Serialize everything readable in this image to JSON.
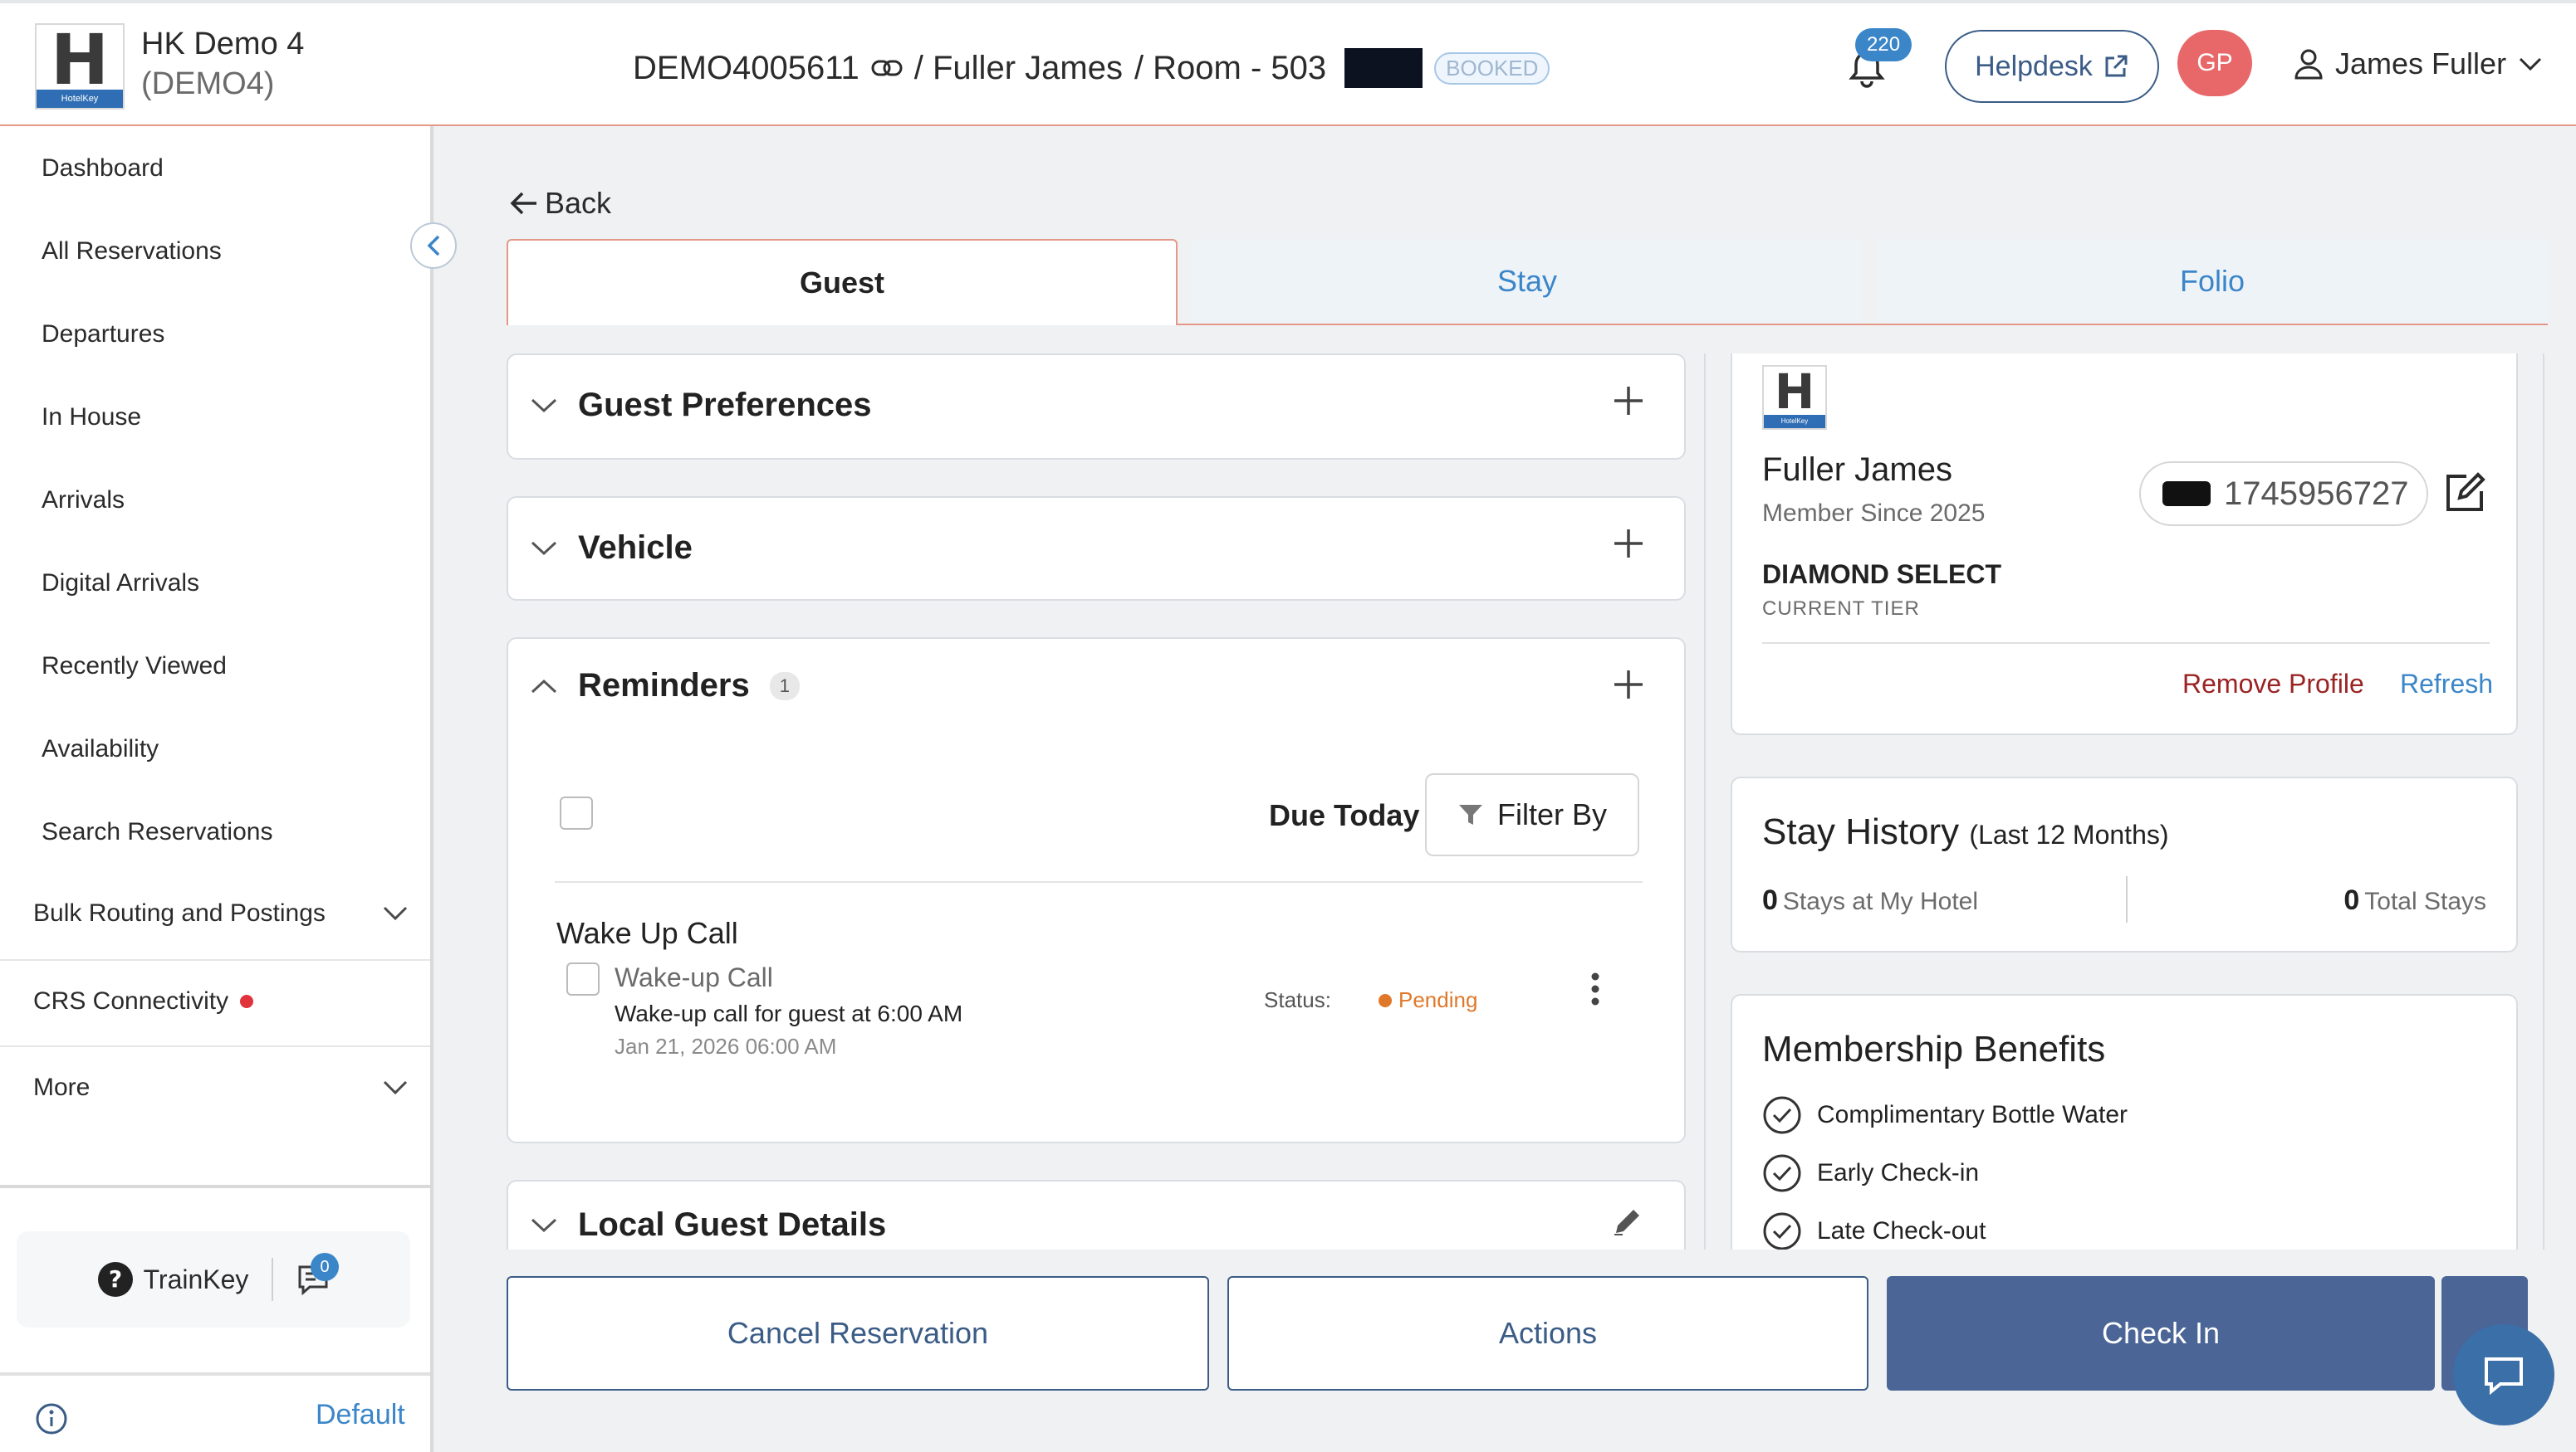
{
  "header": {
    "hotel_name": "HK Demo 4",
    "hotel_code": "(DEMO4)",
    "logo_letter": "H",
    "logo_band": "HotelKey",
    "reservation_id": "DEMO4005611",
    "guest_path": "/ Fuller James",
    "room_path": "/ Room - 503",
    "status_badge": "BOOKED",
    "notification_count": "220",
    "helpdesk_label": "Helpdesk",
    "avatar_initials": "GP",
    "user_name": "James Fuller"
  },
  "sidebar": {
    "items": [
      {
        "label": "Dashboard"
      },
      {
        "label": "All Reservations"
      },
      {
        "label": "Departures"
      },
      {
        "label": "In House"
      },
      {
        "label": "Arrivals"
      },
      {
        "label": "Digital Arrivals"
      },
      {
        "label": "Recently Viewed"
      },
      {
        "label": "Availability"
      },
      {
        "label": "Search Reservations"
      }
    ],
    "bulk_routing": "Bulk Routing and Postings",
    "crs": "CRS Connectivity",
    "more": "More",
    "trainkey": "TrainKey",
    "message_count": "0",
    "default_label": "Default"
  },
  "main": {
    "back_label": "Back",
    "tabs": [
      {
        "label": "Guest",
        "active": true
      },
      {
        "label": "Stay",
        "active": false
      },
      {
        "label": "Folio",
        "active": false
      }
    ],
    "sections": {
      "guest_preferences": "Guest Preferences",
      "vehicle": "Vehicle",
      "reminders": "Reminders",
      "reminders_count": "1",
      "local_guest_details": "Local Guest Details"
    },
    "reminders": {
      "due_today": "Due Today",
      "filter_by": "Filter By",
      "group_title": "Wake Up Call",
      "item_name": "Wake-up Call",
      "item_desc": "Wake-up call for guest at 6:00 AM",
      "item_date": "Jan 21, 2026 06:00 AM",
      "status_label": "Status:",
      "status_value": "Pending"
    }
  },
  "profile": {
    "logo_letter": "H",
    "logo_band": "HotelKey",
    "guest_name": "Fuller James",
    "member_since": "Member Since 2025",
    "loyalty_number": "1745956727",
    "tier": "DIAMOND SELECT",
    "tier_label": "CURRENT TIER",
    "remove_profile": "Remove Profile",
    "refresh": "Refresh"
  },
  "stay_history": {
    "title": "Stay History",
    "subtitle": "(Last 12 Months)",
    "stays_at_hotel_count": "0",
    "stays_at_hotel_label": "Stays at My Hotel",
    "total_stays_count": "0",
    "total_stays_label": "Total Stays"
  },
  "membership": {
    "title": "Membership Benefits",
    "benefits": [
      {
        "label": "Complimentary Bottle Water"
      },
      {
        "label": "Early Check-in"
      },
      {
        "label": "Late Check-out"
      }
    ]
  },
  "footer": {
    "cancel_label": "Cancel Reservation",
    "actions_label": "Actions",
    "checkin_label": "Check In"
  },
  "colors": {
    "accent_blue": "#3b86c8",
    "navy": "#3a5c86",
    "primary_button": "#4a6596",
    "tab_border": "#e39888",
    "danger": "#9b2323",
    "pending": "#e0782a"
  }
}
